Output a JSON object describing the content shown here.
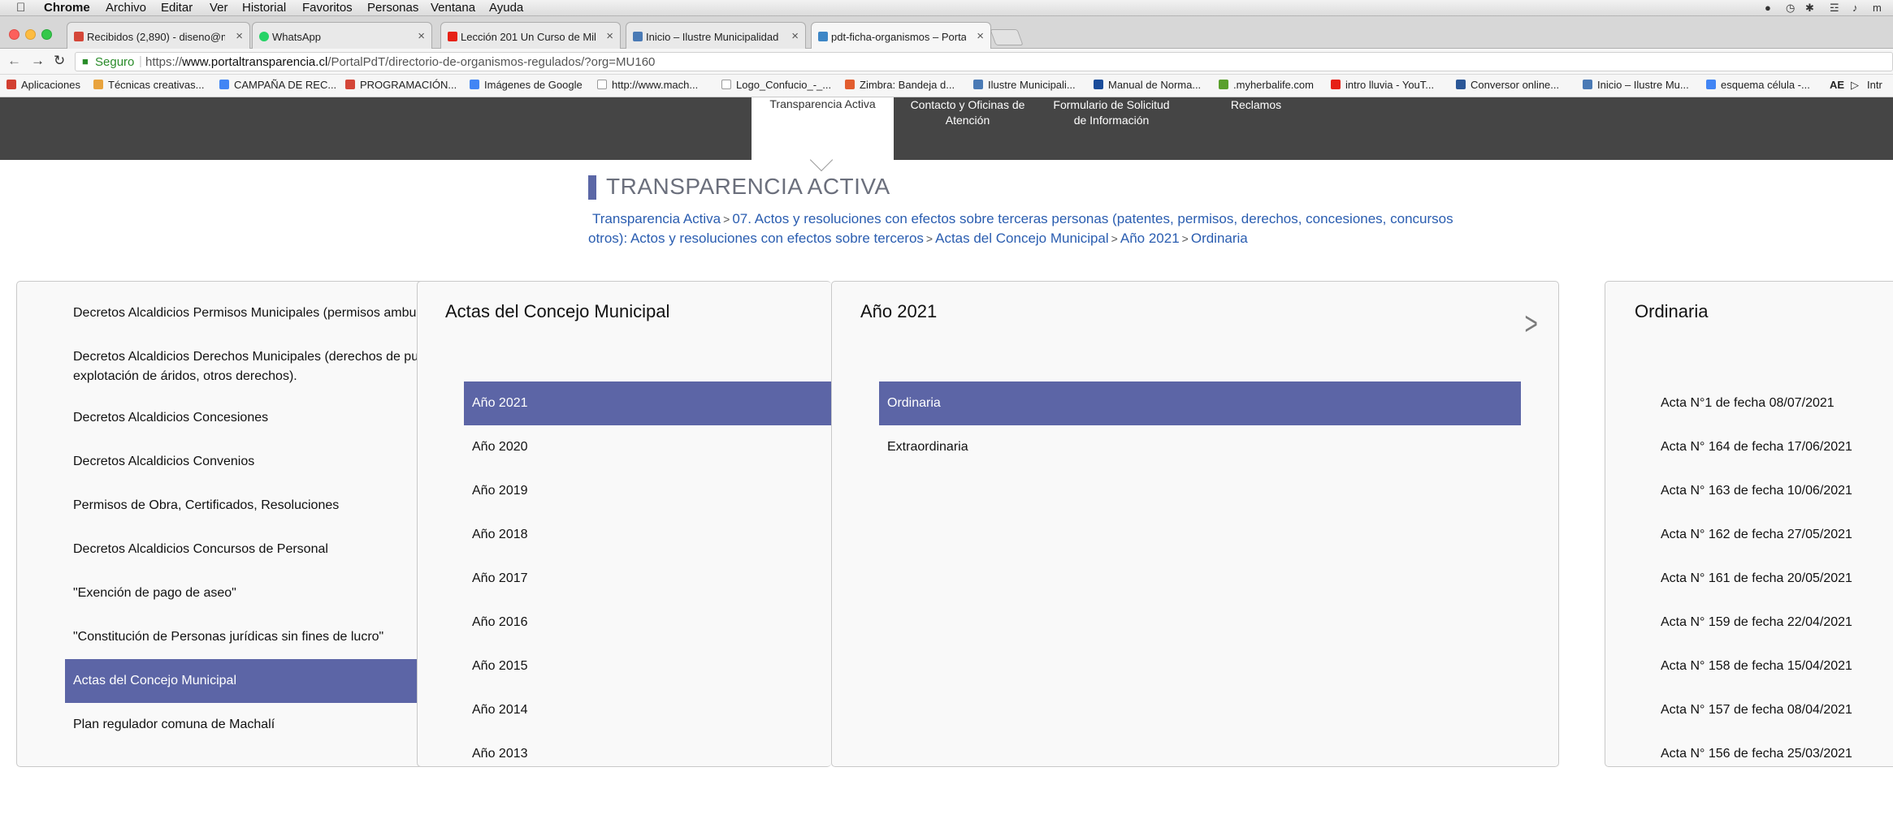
{
  "menubar": {
    "app": "Chrome",
    "items": [
      "Archivo",
      "Editar",
      "Ver",
      "Historial",
      "Favoritos",
      "Personas",
      "Ventana",
      "Ayuda"
    ],
    "tray_text": "m"
  },
  "tabs": [
    {
      "title": "Recibidos (2,890) - diseno@m",
      "icon": "gmail-icon",
      "color": "#d44638"
    },
    {
      "title": "WhatsApp",
      "icon": "whatsapp-icon",
      "color": "#25d366"
    },
    {
      "title": "Lección 201 Un Curso de Mila",
      "icon": "youtube-icon",
      "color": "#e62117"
    },
    {
      "title": "Inicio – Ilustre Municipalidad",
      "icon": "municipality-icon",
      "color": "#4a7ab5"
    },
    {
      "title": "pdt-ficha-organismos – Porta",
      "icon": "portal-icon",
      "color": "#3d86c6"
    }
  ],
  "toolbar": {
    "secure_label": "Seguro",
    "url_prefix": "https://",
    "url_host": "www.portaltransparencia.cl",
    "url_path": "/PortalPdT/directorio-de-organismos-regulados/?org=MU160"
  },
  "bookmarks": [
    {
      "label": "Aplicaciones",
      "color": "#d23f31"
    },
    {
      "label": "Técnicas creativas...",
      "color": "#e8a33d"
    },
    {
      "label": "CAMPAÑA DE REC...",
      "color": "#4285f4"
    },
    {
      "label": "PROGRAMACIÓN...",
      "color": "#d44638"
    },
    {
      "label": "Imágenes de Google",
      "color": "#4285f4"
    },
    {
      "label": "http://www.mach...",
      "color": "#bbbbbb"
    },
    {
      "label": "Logo_Confucio_-_...",
      "color": "#bbbbbb"
    },
    {
      "label": "Zimbra: Bandeja d...",
      "color": "#e25d2f"
    },
    {
      "label": "Ilustre Municipali...",
      "color": "#4a7ab5"
    },
    {
      "label": "Manual de Norma...",
      "color": "#1a4c9a"
    },
    {
      "label": ".myherbalife.com",
      "color": "#5aa02c"
    },
    {
      "label": "intro lluvia - YouT...",
      "color": "#e62117"
    },
    {
      "label": "Conversor online...",
      "color": "#2b5797"
    },
    {
      "label": "Inicio – Ilustre Mu...",
      "color": "#4a7ab5"
    },
    {
      "label": "esquema célula -...",
      "color": "#4285f4"
    },
    {
      "label": "AE",
      "color": "#333333"
    },
    {
      "label": "Intr",
      "color": "#bbbbbb"
    }
  ],
  "sitenav": {
    "active": "Transparencia Activa",
    "items": [
      {
        "line1": "Contacto y Oficinas de",
        "line2": "Atención"
      },
      {
        "line1": "Formulario de Solicitud",
        "line2": "de Información"
      },
      {
        "line1": "Reclamos",
        "line2": ""
      }
    ]
  },
  "header": {
    "title": "TRANSPARENCIA ACTIVA"
  },
  "breadcrumb": {
    "items": [
      "Transparencia Activa",
      "07. Actos y resoluciones con efectos sobre terceras personas (patentes, permisos, derechos, concesiones, concursos otros): Actos y resoluciones con efectos sobre terceros",
      "Actas del Concejo Municipal",
      "Año 2021",
      "Ordinaria"
    ]
  },
  "panel1": {
    "items": [
      "Decretos Alcaldicios Permisos Municipales (permisos ambu",
      "Decretos Alcaldicios Derechos Municipales (derechos de pu explotación de áridos, otros derechos).",
      "Decretos Alcaldicios Concesiones",
      "Decretos Alcaldicios Convenios",
      "Permisos de Obra, Certificados, Resoluciones",
      "Decretos Alcaldicios Concursos de Personal",
      "\"Exención de pago de aseo\"",
      "\"Constitución de Personas jurídicas sin fines de lucro\"",
      "Actas del Concejo Municipal",
      "Plan regulador comuna de Machalí"
    ],
    "selected_index": 8
  },
  "panel2": {
    "title": "Actas del Concejo Municipal",
    "items": [
      "Año 2021",
      "Año 2020",
      "Año 2019",
      "Año 2018",
      "Año 2017",
      "Año 2016",
      "Año 2015",
      "Año 2014",
      "Año 2013"
    ],
    "selected_index": 0
  },
  "panel3": {
    "title": "Año 2021",
    "items": [
      "Ordinaria",
      "Extraordinaria"
    ],
    "selected_index": 0
  },
  "panel4": {
    "title": "Ordinaria",
    "items": [
      "Acta N°1 de fecha 08/07/2021",
      "Acta N° 164 de fecha 17/06/2021",
      "Acta N° 163 de fecha 10/06/2021",
      "Acta N° 162 de fecha 27/05/2021",
      "Acta N° 161 de fecha 20/05/2021",
      "Acta N° 159 de fecha 22/04/2021",
      "Acta N° 158 de fecha 15/04/2021",
      "Acta N° 157 de fecha 08/04/2021",
      "Acta N° 156 de fecha 25/03/2021"
    ]
  },
  "colors": {
    "accent": "#5c65a6",
    "nav": "#454545",
    "link": "#2a5db0"
  }
}
